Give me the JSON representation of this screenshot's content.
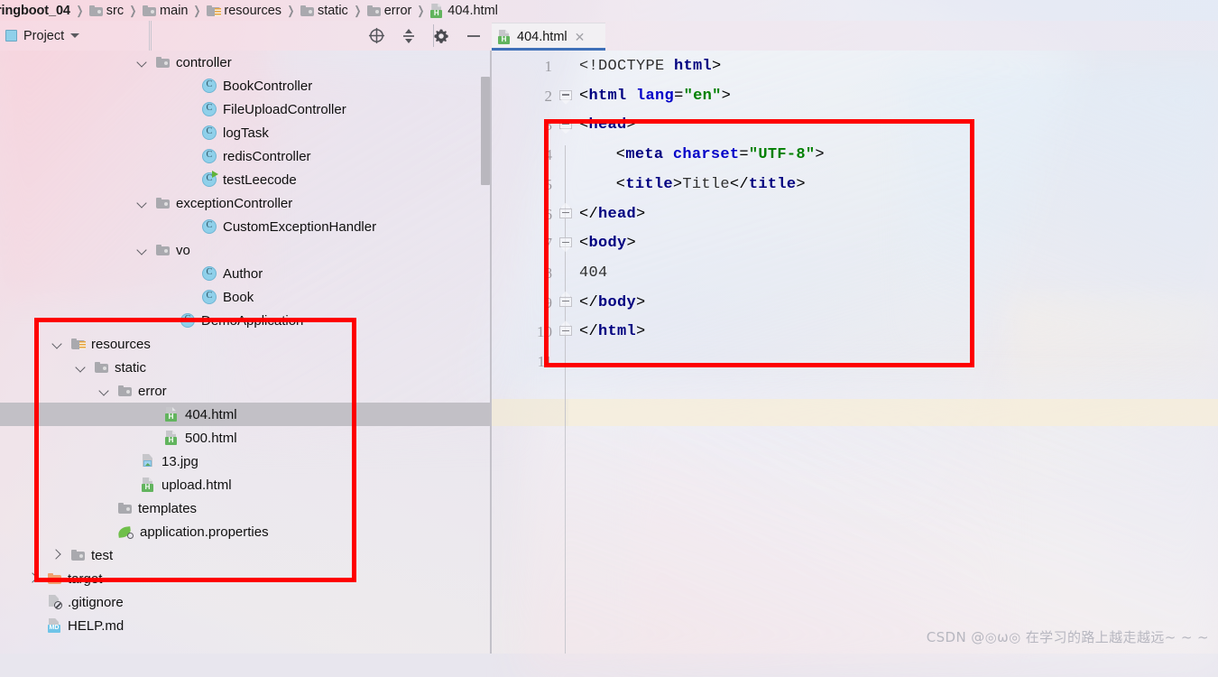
{
  "breadcrumb": {
    "separator": "❯",
    "items": [
      {
        "label": "ringboot_04",
        "icon": "none"
      },
      {
        "label": "src",
        "icon": "folder-icon"
      },
      {
        "label": "main",
        "icon": "folder-icon"
      },
      {
        "label": "resources",
        "icon": "resources-folder-icon"
      },
      {
        "label": "static",
        "icon": "folder-icon"
      },
      {
        "label": "error",
        "icon": "folder-icon"
      },
      {
        "label": "404.html",
        "icon": "html-file-icon"
      }
    ]
  },
  "tool_window": {
    "title": "Project",
    "dropdown_caret": "▾",
    "toolbar": [
      {
        "name": "select-opened-file-icon",
        "label": "Select Opened File"
      },
      {
        "name": "collapse-all-icon",
        "label": "Collapse All"
      },
      {
        "name": "settings-gear-icon",
        "label": "Settings"
      },
      {
        "name": "hide-icon",
        "label": "Hide"
      }
    ]
  },
  "editor_tabs": [
    {
      "label": "404.html",
      "icon": "html-file-icon",
      "close": "✕",
      "active": true
    }
  ],
  "project_tree": {
    "selected": "404.html",
    "rows": [
      {
        "label": "controller",
        "icon": "folder-icon",
        "arrow": "down",
        "indent": 152
      },
      {
        "label": "BookController",
        "icon": "class-icon",
        "arrow": "none",
        "indent": 203
      },
      {
        "label": "FileUploadController",
        "icon": "class-icon",
        "arrow": "none",
        "indent": 203
      },
      {
        "label": "logTask",
        "icon": "class-icon",
        "arrow": "none",
        "indent": 203
      },
      {
        "label": "redisController",
        "icon": "class-icon",
        "arrow": "none",
        "indent": 203
      },
      {
        "label": "testLeecode",
        "icon": "class-runnable-icon",
        "arrow": "none",
        "indent": 203
      },
      {
        "label": "exceptionController",
        "icon": "folder-icon",
        "arrow": "down",
        "indent": 152
      },
      {
        "label": "CustomExceptionHandler",
        "icon": "class-icon",
        "arrow": "none",
        "indent": 203
      },
      {
        "label": "vo",
        "icon": "folder-icon",
        "arrow": "down",
        "indent": 152
      },
      {
        "label": "Author",
        "icon": "class-icon",
        "arrow": "none",
        "indent": 203
      },
      {
        "label": "Book",
        "icon": "class-icon",
        "arrow": "none",
        "indent": 203
      },
      {
        "label": "DemoApplication",
        "icon": "spring-class-icon",
        "arrow": "none",
        "indent": 179
      },
      {
        "label": "resources",
        "icon": "resources-folder-icon",
        "arrow": "down",
        "indent": 58
      },
      {
        "label": "static",
        "icon": "folder-icon",
        "arrow": "down",
        "indent": 84
      },
      {
        "label": "error",
        "icon": "folder-icon",
        "arrow": "down",
        "indent": 110
      },
      {
        "label": "404.html",
        "icon": "html-file-icon",
        "arrow": "none",
        "indent": 162
      },
      {
        "label": "500.html",
        "icon": "html-file-icon",
        "arrow": "none",
        "indent": 162
      },
      {
        "label": "13.jpg",
        "icon": "image-file-icon",
        "arrow": "none",
        "indent": 136
      },
      {
        "label": "upload.html",
        "icon": "html-file-icon",
        "arrow": "none",
        "indent": 136
      },
      {
        "label": "templates",
        "icon": "folder-icon",
        "arrow": "none",
        "indent": 110
      },
      {
        "label": "application.properties",
        "icon": "properties-icon",
        "arrow": "none",
        "indent": 110
      },
      {
        "label": "test",
        "icon": "folder-icon",
        "arrow": "right",
        "indent": 58
      },
      {
        "label": "target",
        "icon": "excluded-folder-icon",
        "arrow": "right",
        "indent": 32
      },
      {
        "label": ".gitignore",
        "icon": "gitignore-icon",
        "arrow": "none",
        "indent": 32
      },
      {
        "label": "HELP.md",
        "icon": "markdown-icon",
        "arrow": "none",
        "indent": 32
      }
    ]
  },
  "code": {
    "language": "HTML",
    "line_numbers": [
      "1",
      "2",
      "3",
      "4",
      "5",
      "6",
      "7",
      "8",
      "9",
      "10",
      "11"
    ],
    "current_line": 11,
    "lines": [
      {
        "n": 1,
        "indent": 0,
        "tokens": [
          {
            "t": "<!DOCTYPE ",
            "c": "doct"
          },
          {
            "t": "html",
            "c": "tag"
          },
          {
            "t": ">",
            "c": "punc"
          }
        ]
      },
      {
        "n": 2,
        "indent": 0,
        "tokens": [
          {
            "t": "<",
            "c": "punc"
          },
          {
            "t": "html",
            "c": "tag"
          },
          {
            "t": " ",
            "c": "punc"
          },
          {
            "t": "lang",
            "c": "attr"
          },
          {
            "t": "=",
            "c": "punc"
          },
          {
            "t": "\"en\"",
            "c": "str"
          },
          {
            "t": ">",
            "c": "punc"
          }
        ]
      },
      {
        "n": 3,
        "indent": 0,
        "tokens": [
          {
            "t": "<",
            "c": "punc"
          },
          {
            "t": "head",
            "c": "tag"
          },
          {
            "t": ">",
            "c": "punc"
          }
        ]
      },
      {
        "n": 4,
        "indent": 4,
        "tokens": [
          {
            "t": "<",
            "c": "punc"
          },
          {
            "t": "meta",
            "c": "tag"
          },
          {
            "t": " ",
            "c": "punc"
          },
          {
            "t": "charset",
            "c": "attr"
          },
          {
            "t": "=",
            "c": "punc"
          },
          {
            "t": "\"UTF-8\"",
            "c": "str"
          },
          {
            "t": ">",
            "c": "punc"
          }
        ]
      },
      {
        "n": 5,
        "indent": 4,
        "tokens": [
          {
            "t": "<",
            "c": "punc"
          },
          {
            "t": "title",
            "c": "tag"
          },
          {
            "t": ">",
            "c": "punc"
          },
          {
            "t": "Title",
            "c": "txt"
          },
          {
            "t": "</",
            "c": "punc"
          },
          {
            "t": "title",
            "c": "tag"
          },
          {
            "t": ">",
            "c": "punc"
          }
        ]
      },
      {
        "n": 6,
        "indent": 0,
        "tokens": [
          {
            "t": "</",
            "c": "punc"
          },
          {
            "t": "head",
            "c": "tag"
          },
          {
            "t": ">",
            "c": "punc"
          }
        ]
      },
      {
        "n": 7,
        "indent": 0,
        "tokens": [
          {
            "t": "<",
            "c": "punc"
          },
          {
            "t": "body",
            "c": "tag"
          },
          {
            "t": ">",
            "c": "punc"
          }
        ]
      },
      {
        "n": 8,
        "indent": 0,
        "tokens": [
          {
            "t": "404",
            "c": "txt"
          }
        ]
      },
      {
        "n": 9,
        "indent": 0,
        "tokens": [
          {
            "t": "</",
            "c": "punc"
          },
          {
            "t": "body",
            "c": "tag"
          },
          {
            "t": ">",
            "c": "punc"
          }
        ]
      },
      {
        "n": 10,
        "indent": 0,
        "tokens": [
          {
            "t": "</",
            "c": "punc"
          },
          {
            "t": "html",
            "c": "tag"
          },
          {
            "t": ">",
            "c": "punc"
          }
        ]
      },
      {
        "n": 11,
        "indent": 0,
        "tokens": []
      }
    ],
    "fold_markers": [
      {
        "line": 2,
        "dir": "down"
      },
      {
        "line": 3,
        "dir": "down"
      },
      {
        "line": 6,
        "dir": "up"
      },
      {
        "line": 7,
        "dir": "down"
      },
      {
        "line": 9,
        "dir": "up"
      },
      {
        "line": 10,
        "dir": "up"
      }
    ]
  },
  "annotations": [
    {
      "name": "red-highlight-tree",
      "color": "#fe0000"
    },
    {
      "name": "red-highlight-editor",
      "color": "#fe0000"
    }
  ],
  "watermark": {
    "text": "CSDN @◎ω◎ 在学习的路上越走越远~ ~ ~"
  }
}
